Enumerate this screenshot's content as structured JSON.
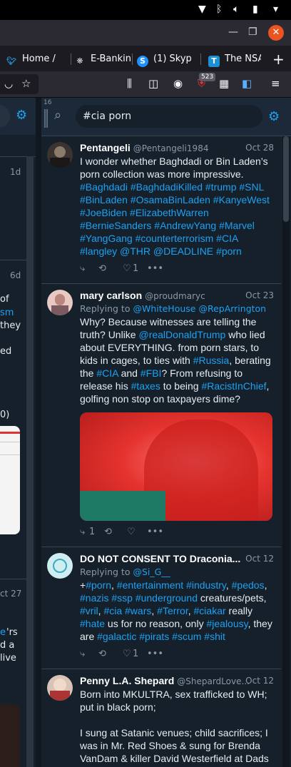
{
  "browser": {
    "tabs": [
      {
        "label": "Home /",
        "icon": "twitter-icon"
      },
      {
        "label": "E-Bankin",
        "icon": "bank-icon"
      },
      {
        "label": "(1) Skyp",
        "icon": "skype-icon"
      },
      {
        "label": "The NSA",
        "icon": "t-logo-icon"
      }
    ],
    "ext_badge": "523"
  },
  "left_column": {
    "fragments": [
      "1d",
      "6d",
      "of",
      "sm",
      "they",
      "ed",
      "0)",
      "ct 27",
      "e",
      "'rs",
      "d a",
      "live"
    ]
  },
  "search_column": {
    "column_number": "16",
    "query": "#cia porn"
  },
  "tweets": [
    {
      "name": "Pentangeli",
      "handle": "@Pentangeli1984",
      "date": "Oct 28",
      "replying": null,
      "segments": [
        {
          "t": "I wonder whether Baghdadi or Bin Laden’s porn collection was more impressive. "
        },
        {
          "t": "#Baghdadi #BaghdadiKilled #trump #SNL #BinLaden #OsamaBinLaden #KanyeWest #JoeBiden #ElizabethWarren #BernieSanders #AndrewYang #Marvel #YangGang #counterterrorism #CIA #langley @THR @DEADLINE #porn",
          "h": true
        }
      ],
      "stats": {
        "replies": "",
        "retweets": "",
        "likes": "1"
      }
    },
    {
      "name": "mary carlson",
      "handle": "@proudmaryc",
      "date": "Oct 23",
      "replying": {
        "prefix": "Replying to ",
        "users": "@WhiteHouse @RepArrington"
      },
      "segments": [
        {
          "t": "Why? Because witnesses are telling the truth? Unlike "
        },
        {
          "t": "@realDonaldTrump",
          "h": true
        },
        {
          "t": " who lied about EVERYTHING. from porn stars, to kids in cages, to ties with "
        },
        {
          "t": "#Russia",
          "h": true
        },
        {
          "t": ", berating the "
        },
        {
          "t": "#CIA",
          "h": true
        },
        {
          "t": " and "
        },
        {
          "t": "#FBI",
          "h": true
        },
        {
          "t": "? From refusing to release his "
        },
        {
          "t": "#taxes",
          "h": true
        },
        {
          "t": " to being "
        },
        {
          "t": "#RacistInChief",
          "h": true
        },
        {
          "t": ", golfing non stop on taxpayers dime?"
        }
      ],
      "has_media": true,
      "stats": {
        "replies": "1",
        "retweets": "",
        "likes": ""
      }
    },
    {
      "name": "DO NOT CONSENT TO Draconia...",
      "handle": "",
      "date": "Oct 12",
      "replying": {
        "prefix": "Replying to ",
        "users": "@Si_G__"
      },
      "segments": [
        {
          "t": "+"
        },
        {
          "t": "#porn",
          "h": true
        },
        {
          "t": ", "
        },
        {
          "t": "#entertainment #industry",
          "h": true
        },
        {
          "t": ", "
        },
        {
          "t": "#pedos",
          "h": true
        },
        {
          "t": ", "
        },
        {
          "t": "#nazis #ssp #underground",
          "h": true
        },
        {
          "t": " creatures/pets, "
        },
        {
          "t": "#vril",
          "h": true
        },
        {
          "t": ", "
        },
        {
          "t": "#cia #wars",
          "h": true
        },
        {
          "t": ", "
        },
        {
          "t": "#Terror",
          "h": true
        },
        {
          "t": ", "
        },
        {
          "t": "#ciakar",
          "h": true
        },
        {
          "t": " really "
        },
        {
          "t": "#hate",
          "h": true
        },
        {
          "t": " us for no reason, only "
        },
        {
          "t": "#jealousy",
          "h": true
        },
        {
          "t": ", they are "
        },
        {
          "t": "#galactic #pirats #scum #shit",
          "h": true
        }
      ],
      "stats": {
        "replies": "",
        "retweets": "",
        "likes": "1"
      }
    },
    {
      "name": "Penny L.A. Shepard",
      "handle": "@ShepardLove...",
      "date": "Oct 12",
      "replying": null,
      "segments": [
        {
          "t": "Born into MKULTRA, sex trafficked to WH; put in black porn;\n\nI sung at Satanic venues; child sacrifices; I was in Mr. Red Shoes & sung for Brenda VanDam & killer David Westerfield at Dads"
        }
      ],
      "stats": {
        "replies": "",
        "retweets": "",
        "likes": ""
      }
    }
  ]
}
